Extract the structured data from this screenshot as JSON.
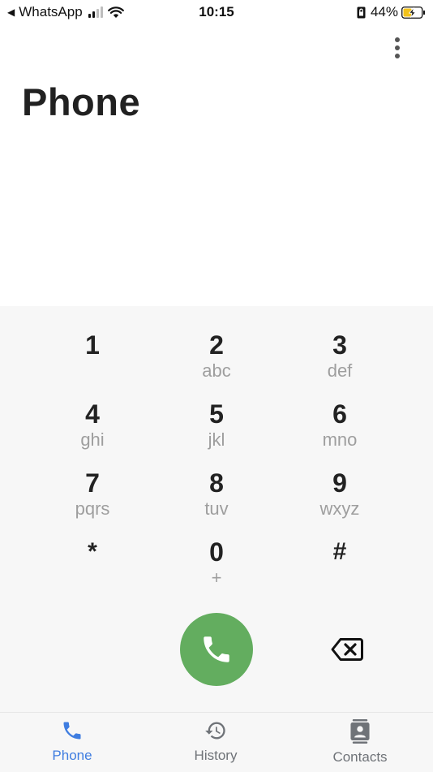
{
  "status_bar": {
    "back_app": "WhatsApp",
    "time": "10:15",
    "battery": "44%"
  },
  "header": {
    "title": "Phone",
    "menu_icon": "more-vert-icon"
  },
  "dialpad": {
    "keys": [
      {
        "digit": "1",
        "letters": ""
      },
      {
        "digit": "2",
        "letters": "abc"
      },
      {
        "digit": "3",
        "letters": "def"
      },
      {
        "digit": "4",
        "letters": "ghi"
      },
      {
        "digit": "5",
        "letters": "jkl"
      },
      {
        "digit": "6",
        "letters": "mno"
      },
      {
        "digit": "7",
        "letters": "pqrs"
      },
      {
        "digit": "8",
        "letters": "tuv"
      },
      {
        "digit": "9",
        "letters": "wxyz"
      },
      {
        "digit": "*",
        "letters": ""
      },
      {
        "digit": "0",
        "letters": "+"
      },
      {
        "digit": "#",
        "letters": ""
      }
    ],
    "call_icon": "phone-icon",
    "backspace_icon": "backspace-icon"
  },
  "bottom_nav": {
    "items": [
      {
        "label": "Phone",
        "icon": "phone-icon",
        "active": true
      },
      {
        "label": "History",
        "icon": "history-icon",
        "active": false
      },
      {
        "label": "Contacts",
        "icon": "contacts-icon",
        "active": false
      }
    ]
  },
  "colors": {
    "accent": "#3f7de0",
    "call_green": "#63ad5f",
    "dialpad_bg": "#f7f7f7"
  }
}
